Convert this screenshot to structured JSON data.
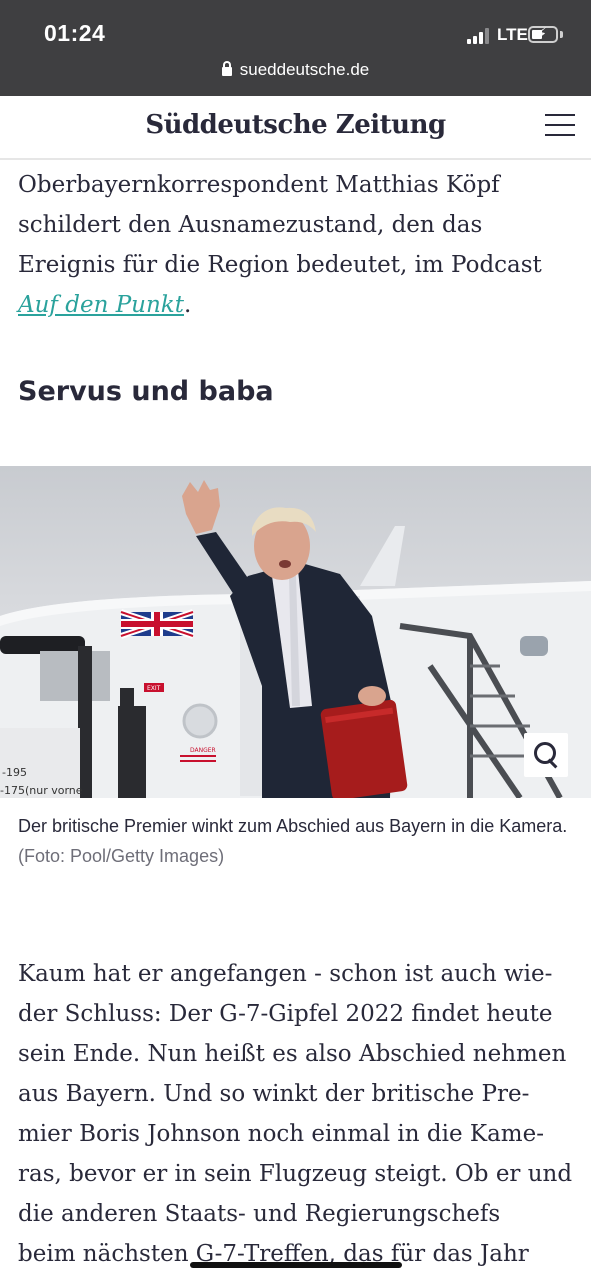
{
  "status_bar": {
    "time": "01:24",
    "network": "LTE",
    "url": "sueddeutsche.de"
  },
  "site": {
    "logo": "Süddeutsche Zeitung"
  },
  "article": {
    "para1_lines": [
      "Oberbayernkorrespondent Matthias Köpf",
      "schildert den Ausnamezustand, den das",
      "Ereignis für die Region bedeutet, im Podcast"
    ],
    "para1_link": "Auf den Punkt",
    "para1_after_link": ".",
    "subheading": "Servus und baba",
    "photo": {
      "sign_text_1": "EXIT",
      "sign_text_2": "DANGER",
      "stair_label_1": "-195",
      "stair_label_2": "-175(nur vorne"
    },
    "caption": "Der britische Premier winkt zum Abschied aus Bayern in die Kamera.",
    "caption_credit": "(Foto: Pool/Getty Images)",
    "para2_lines": [
      "Kaum hat er angefangen - schon ist auch wie-",
      "der Schluss: Der G-7-Gipfel 2022 findet heute",
      "sein Ende. Nun heißt es also Abschied nehmen",
      "aus Bayern. Und so winkt der britische Pre-",
      "mier Boris Johnson noch einmal in die Kame-",
      "ras, bevor er in sein Flugzeug steigt. Ob er und",
      "die anderen Staats- und Regierungschefs",
      "beim nächsten G-7-Treffen, das für das Jahr"
    ]
  },
  "colors": {
    "status_bar_bg": "#3f3f41",
    "text": "#29293a",
    "link": "#2aa29c",
    "caption_credit": "#6e6e78"
  }
}
